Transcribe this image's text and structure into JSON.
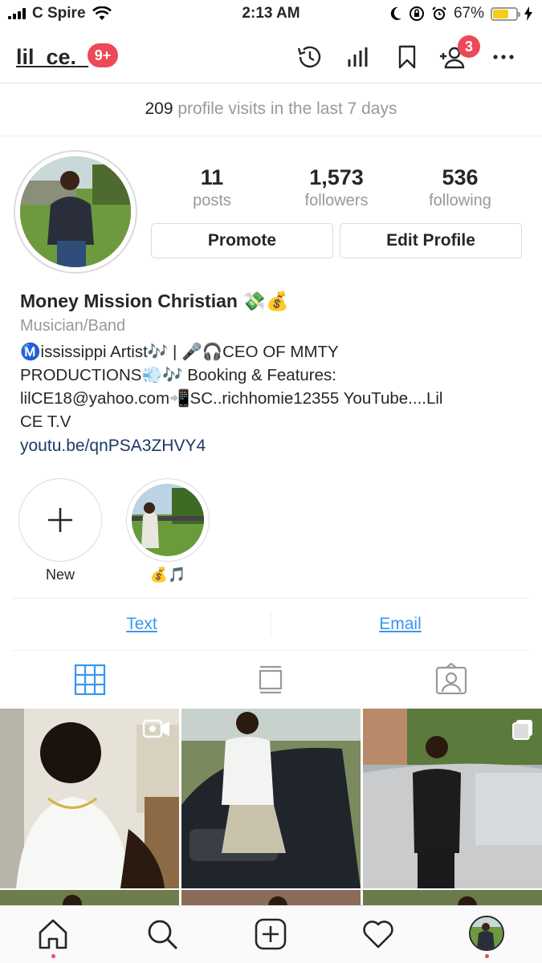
{
  "status_bar": {
    "carrier": "C Spire",
    "time": "2:13 AM",
    "battery": "67%",
    "battery_level": 0.67,
    "battery_color": "#f7cd1c"
  },
  "header": {
    "username": "lil_ce._",
    "notification_badge": "9+",
    "follow_requests_badge": "3",
    "icons": [
      "archive-icon",
      "insights-icon",
      "saved-icon",
      "discover-people-icon",
      "more-icon"
    ]
  },
  "visits": {
    "count": "209",
    "text": " profile visits in the last 7 days"
  },
  "profile": {
    "posts": {
      "value": "11",
      "label": "posts"
    },
    "followers": {
      "value": "1,573",
      "label": "followers"
    },
    "following": {
      "value": "536",
      "label": "following"
    },
    "promote_label": "Promote",
    "edit_label": "Edit Profile",
    "name": "Money Mission Christian 💸💰",
    "category": "Musician/Band",
    "bio": "Ⓜ️ississippi Artist🎶 | 🎤🎧CEO OF MMTY\nPRODUCTIONS💨🎶 Booking & Features:\nlilCE18@yahoo.com📲SC..richhomie12355 YouTube....Lil\nCE T.V",
    "link": "youtu.be/qnPSA3ZHVY4"
  },
  "highlights": [
    {
      "label": "New"
    },
    {
      "label": "💰🎵"
    }
  ],
  "contact": {
    "text_label": "Text",
    "email_label": "Email"
  },
  "colors": {
    "accent": "#3897f0",
    "badge": "#ed4956",
    "link": "#1b3a63"
  }
}
